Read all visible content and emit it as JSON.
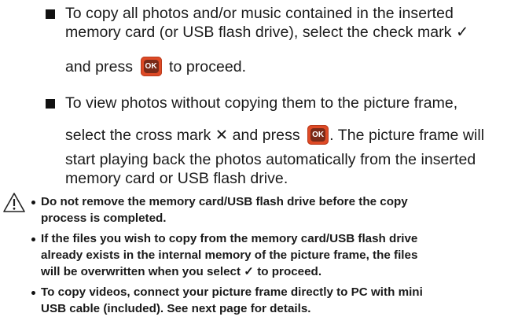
{
  "steps": [
    {
      "line1": "To copy all photos and/or music contained in the inserted",
      "line2": "memory card (or USB flash drive), select the check mark ✓",
      "line3_before": "and press",
      "line3_after": "to proceed."
    },
    {
      "line1": "To view photos without copying them to the picture frame,",
      "line2_before": "select the cross mark ✕ and press",
      "line2_after": ". The picture frame will",
      "line3": "start playing back the photos automatically from the inserted",
      "line4": "memory card or USB flash drive."
    }
  ],
  "ok_button_label": "OK",
  "warning_icon": "warning-triangle-icon",
  "notes": [
    {
      "line1": "Do not remove the memory card/USB flash drive before the copy",
      "line2": "process is completed."
    },
    {
      "line1": "If the files you wish to copy from the memory card/USB flash drive",
      "line2": "already exists in the internal memory of the picture frame, the files",
      "line3": "will be overwritten when you select ✓ to proceed."
    },
    {
      "line1": "To copy videos, connect your picture frame directly to PC with mini",
      "line2": "USB cable (included). See next page for details."
    }
  ]
}
